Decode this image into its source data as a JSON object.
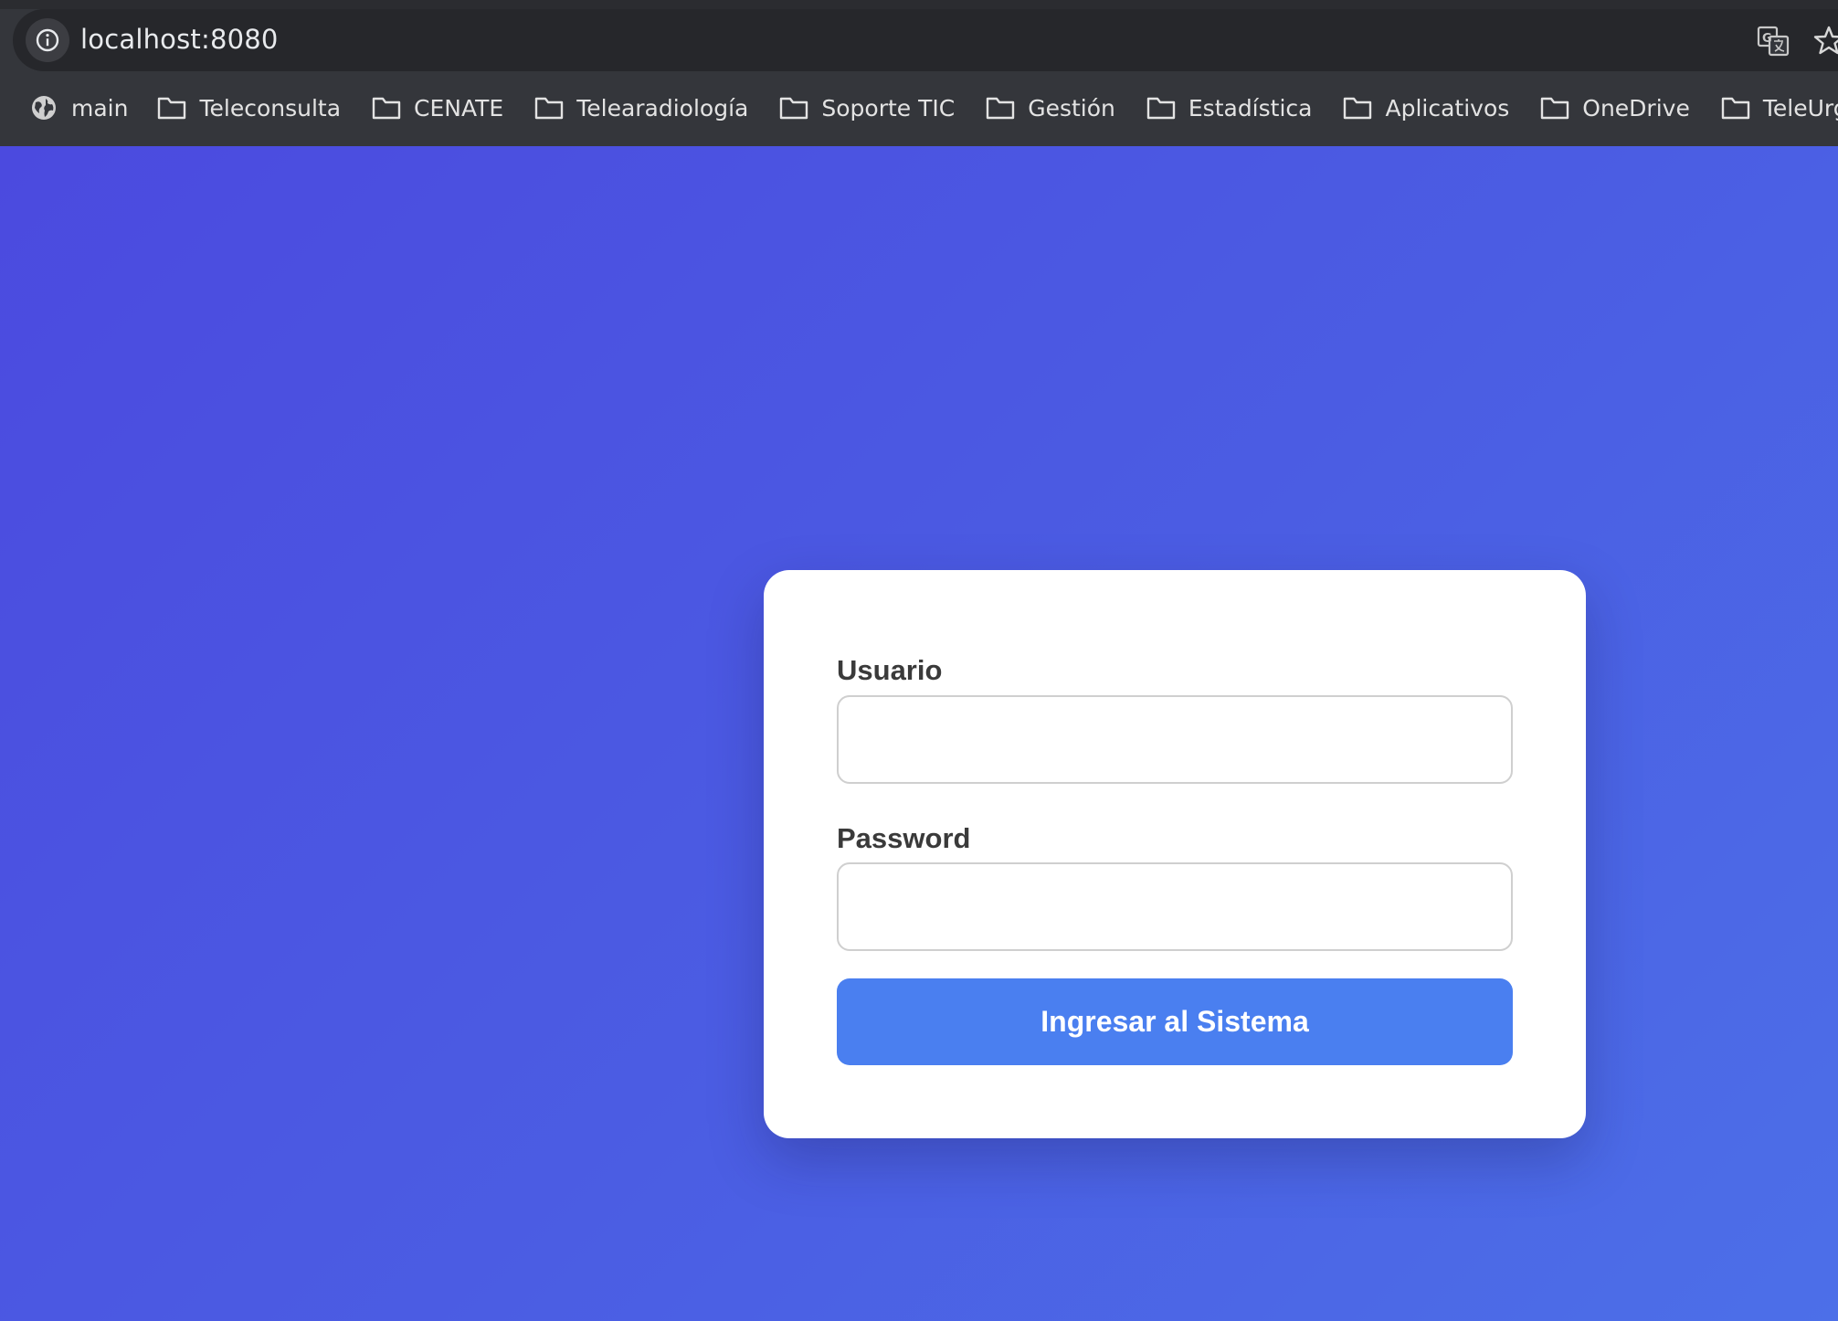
{
  "browser": {
    "url": "localhost:8080",
    "icons": {
      "site_info": "info-icon",
      "translate": "translate-icon",
      "bookmark_star": "star-icon"
    },
    "bookmarks": [
      {
        "label": "main",
        "icon": "globe-icon"
      },
      {
        "label": "Teleconsulta",
        "icon": "folder-icon"
      },
      {
        "label": "CENATE",
        "icon": "folder-icon"
      },
      {
        "label": "Telearadiología",
        "icon": "folder-icon"
      },
      {
        "label": "Soporte TIC",
        "icon": "folder-icon"
      },
      {
        "label": "Gestión",
        "icon": "folder-icon"
      },
      {
        "label": "Estadística",
        "icon": "folder-icon"
      },
      {
        "label": "Aplicativos",
        "icon": "folder-icon"
      },
      {
        "label": "OneDrive",
        "icon": "folder-icon"
      },
      {
        "label": "TeleUrgencia",
        "icon": "folder-icon"
      }
    ]
  },
  "login": {
    "username_label": "Usuario",
    "username_value": "",
    "password_label": "Password",
    "password_value": "",
    "submit_label": "Ingresar al Sistema"
  },
  "colors": {
    "chrome_bg": "#34363b",
    "address_bar_bg": "#26272b",
    "page_gradient_start": "#4b4adf",
    "page_gradient_end": "#4c6fe8",
    "button_bg": "#4a7ff0",
    "card_bg": "#ffffff"
  }
}
